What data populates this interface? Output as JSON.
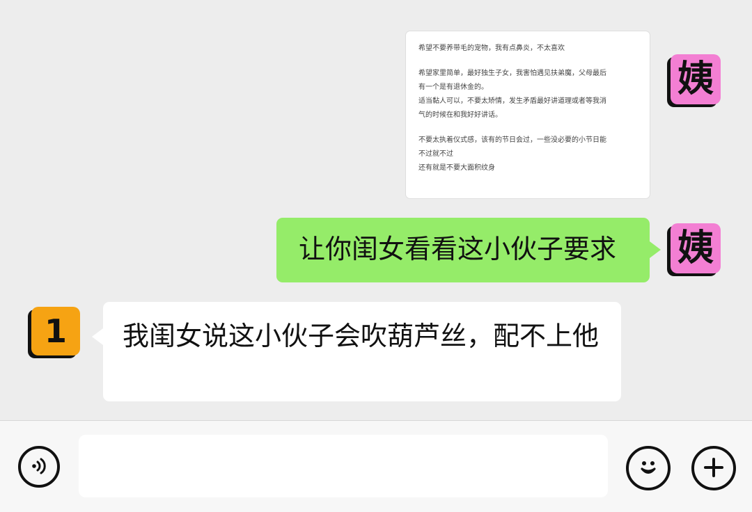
{
  "chat": {
    "messages": [
      {
        "type": "image",
        "sender_avatar": "姨",
        "content": {
          "lines": [
            "希望不要养带毛的宠物，我有点鼻炎，不太喜欢",
            "",
            "希望家里简单，最好独生子女，我害怕遇见扶弟魔，父母最后",
            "有一个是有退休金的。",
            "适当黏人可以，不要太矫情，发生矛盾最好讲道理或者等我消",
            "气的时候在和我好好讲话。",
            "",
            "不要太执着仪式感，该有的节日会过，一些没必要的小节日能",
            "不过就不过",
            "还有就是不要大面积纹身"
          ]
        }
      },
      {
        "type": "text",
        "sender_avatar": "姨",
        "text": "让你闺女看看这小伙子要求"
      },
      {
        "type": "text",
        "sender_avatar": "1",
        "text": "我闺女说这小伙子会吹葫芦丝，配不上他"
      }
    ]
  },
  "input_bar": {
    "voice_icon": "voice-icon",
    "emoji_icon": "emoji-icon",
    "plus_icon": "plus-icon",
    "value": "",
    "placeholder": ""
  },
  "colors": {
    "chat_background": "#ededed",
    "input_bar_background": "#f7f7f7",
    "sent_bubble": "#95ec69",
    "received_bubble": "#ffffff",
    "pink_avatar": "#f37fd3",
    "orange_avatar": "#f6a313"
  }
}
